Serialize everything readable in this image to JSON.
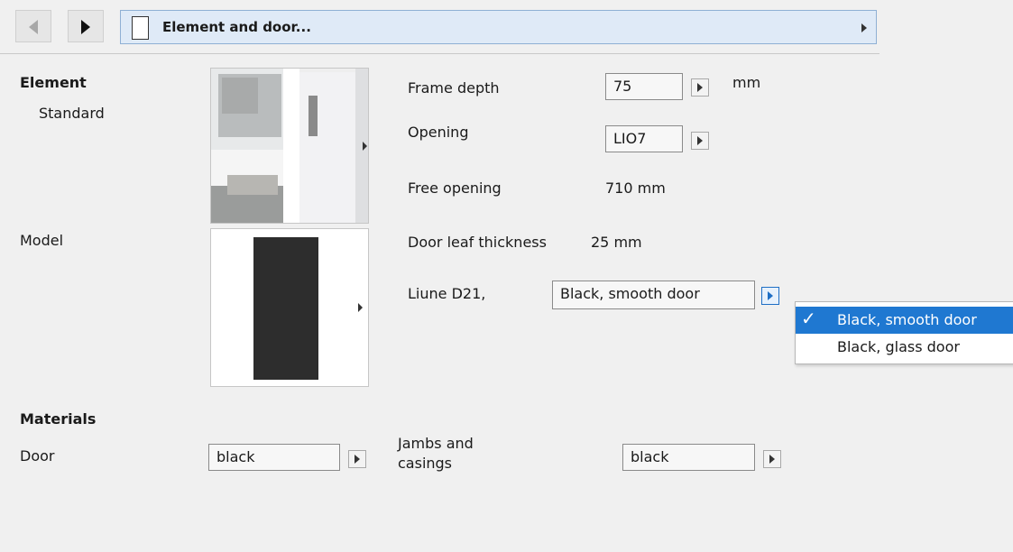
{
  "header": {
    "title": "Element and door...",
    "back_icon": "chevron-left-icon",
    "forward_icon": "chevron-right-icon",
    "doc_icon": "document-icon"
  },
  "left": {
    "element_label": "Element",
    "standard_label": "Standard",
    "model_label": "Model",
    "materials_label": "Materials",
    "door_label": "Door",
    "door_material": "black"
  },
  "right": {
    "frame_depth_label": "Frame depth",
    "frame_depth_value": "75",
    "frame_depth_unit": "mm",
    "opening_label": "Opening",
    "opening_value": "LIO7",
    "free_opening_label": "Free opening",
    "free_opening_value": "710 mm",
    "door_leaf_label": "Door leaf thickness",
    "door_leaf_value": "25 mm",
    "liune_label": "Liune D21,",
    "liune_value": "Black, smooth door",
    "jambs_label_line1": "Jambs and",
    "jambs_label_line2": "casings",
    "jambs_material": "black"
  },
  "dropdown": {
    "items": [
      {
        "label": "Black, smooth door",
        "selected": true
      },
      {
        "label": "Black, glass door",
        "selected": false
      }
    ]
  },
  "colors": {
    "accent": "#1f78d1",
    "header_bg": "#dfeaf7",
    "panel_bg": "#f0f0f0"
  }
}
